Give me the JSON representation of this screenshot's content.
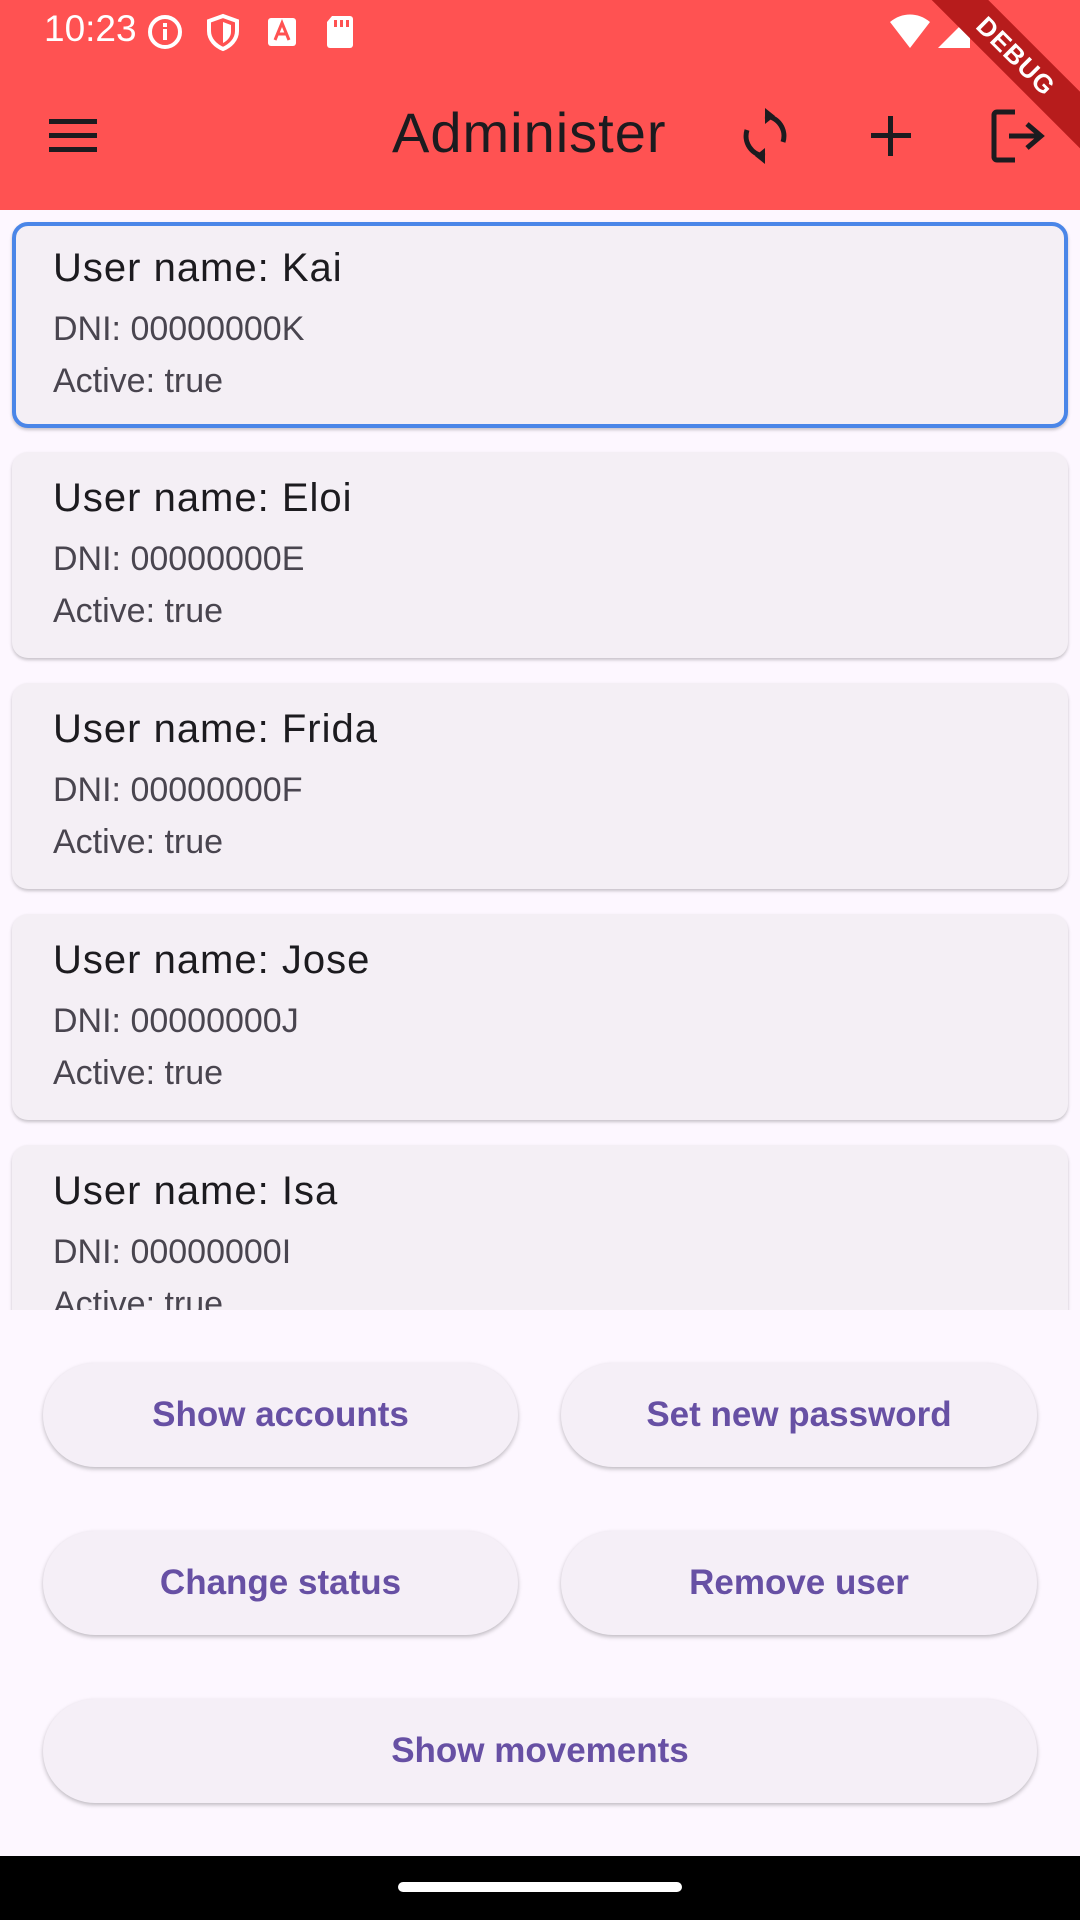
{
  "status_bar": {
    "time": "10:23",
    "debug_label": "DEBUG"
  },
  "app_bar": {
    "title": "Administer",
    "icons": [
      "menu-icon",
      "refresh-icon",
      "add-icon",
      "logout-icon"
    ]
  },
  "users": [
    {
      "name": "User name: Kai",
      "dni": "DNI: 00000000K",
      "active": "Active: true",
      "selected": true
    },
    {
      "name": "User name: Eloi",
      "dni": "DNI: 00000000E",
      "active": "Active: true",
      "selected": false
    },
    {
      "name": "User name: Frida",
      "dni": "DNI: 00000000F",
      "active": "Active: true",
      "selected": false
    },
    {
      "name": "User name: Jose",
      "dni": "DNI: 00000000J",
      "active": "Active: true",
      "selected": false
    },
    {
      "name": "User name: Isa",
      "dni": "DNI: 00000000I",
      "active": "Active: true",
      "selected": false
    }
  ],
  "actions": {
    "show_accounts": "Show accounts",
    "set_new_password": "Set new password",
    "change_status": "Change status",
    "remove_user": "Remove user",
    "show_movements": "Show movements"
  },
  "colors": {
    "app_bar": "#ff5252",
    "selection_border": "#4a86e8",
    "button_text": "#6750a4",
    "background": "#fdf7ff"
  }
}
